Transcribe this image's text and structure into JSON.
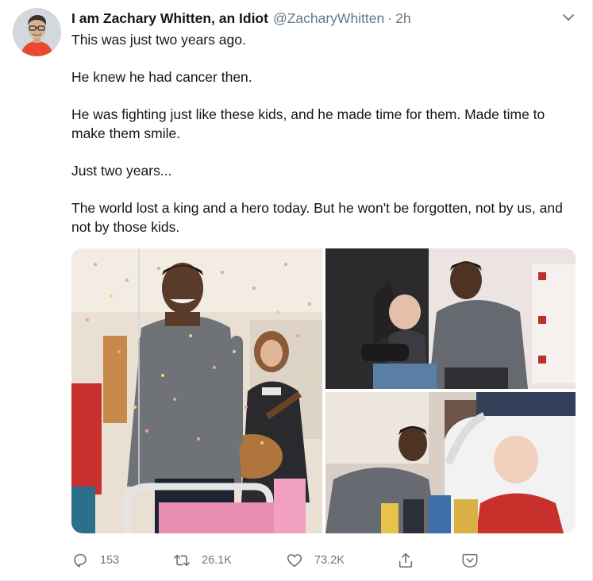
{
  "tweet": {
    "display_name": "I am Zachary Whitten, an Idiot",
    "handle": "@ZacharyWhitten",
    "separator": "·",
    "time": "2h",
    "paragraphs": [
      "This was just two years ago.",
      "He knew he had cancer then.",
      "He was fighting just like these kids, and he made time for them. Made time to make them smile.",
      "Just two years...",
      "The world lost a king and a hero today. But he won't be forgotten, not by us, and not by those kids."
    ]
  },
  "actions": {
    "reply": {
      "icon": "reply-icon",
      "count": "153"
    },
    "retweet": {
      "icon": "retweet-icon",
      "count": "26.1K"
    },
    "like": {
      "icon": "heart-icon",
      "count": "73.2K"
    },
    "share": {
      "icon": "share-icon"
    },
    "more": {
      "icon": "down-chevron-icon"
    }
  },
  "colors": {
    "text": "#14171a",
    "secondary": "#657786",
    "border": "#e6ecf0"
  }
}
